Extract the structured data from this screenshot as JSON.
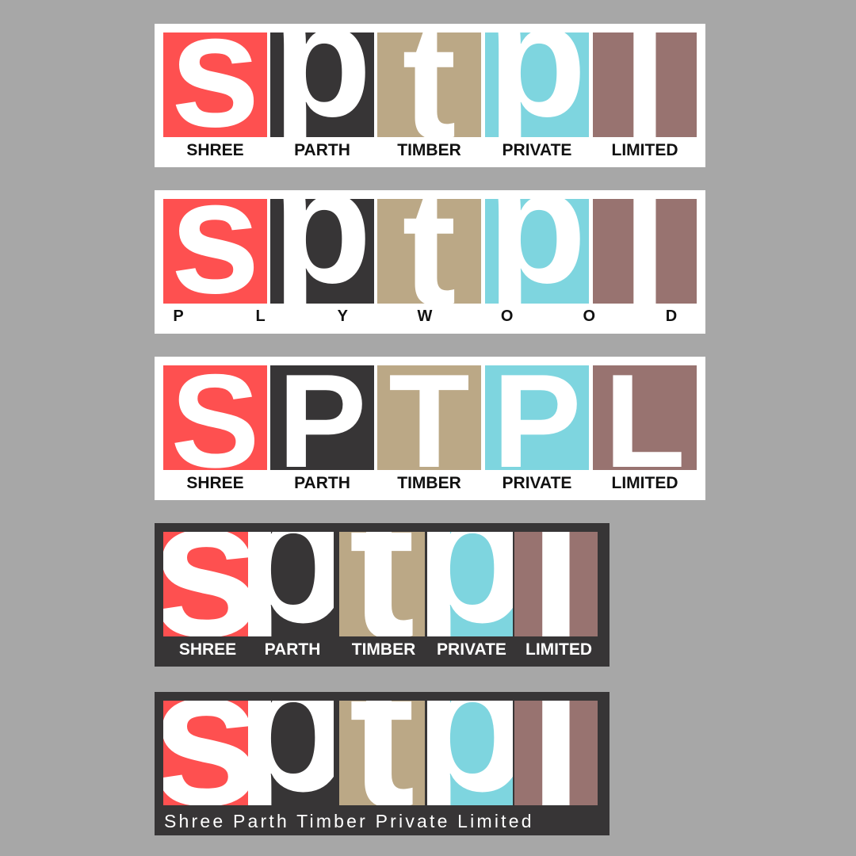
{
  "colors": {
    "red": "#fe5050",
    "dark": "#373536",
    "tan": "#bba886",
    "cyan": "#7ed5df",
    "brown": "#987370"
  },
  "logos": [
    {
      "theme": "light",
      "letters": [
        "s",
        "p",
        "t",
        "p",
        "l"
      ],
      "labels": [
        "SHREE",
        "PARTH",
        "TIMBER",
        "PRIVATE",
        "LIMITED"
      ]
    },
    {
      "theme": "light",
      "letters": [
        "s",
        "p",
        "t",
        "p",
        "l"
      ],
      "labels": [
        "P",
        "L",
        "Y",
        "W",
        "O",
        "O",
        "D"
      ]
    },
    {
      "theme": "light",
      "letters": [
        "S",
        "P",
        "T",
        "P",
        "L"
      ],
      "labels": [
        "SHREE",
        "PARTH",
        "TIMBER",
        "PRIVATE",
        "LIMITED"
      ]
    },
    {
      "theme": "dark",
      "letters": [
        "s",
        "p",
        "t",
        "p",
        "l"
      ],
      "labels": [
        "SHREE",
        "PARTH",
        "TIMBER",
        "PRIVATE",
        "LIMITED"
      ]
    },
    {
      "theme": "dark",
      "letters": [
        "s",
        "p",
        "t",
        "p",
        "l"
      ],
      "tagline": "Shree Parth Timber Private Limited"
    }
  ]
}
